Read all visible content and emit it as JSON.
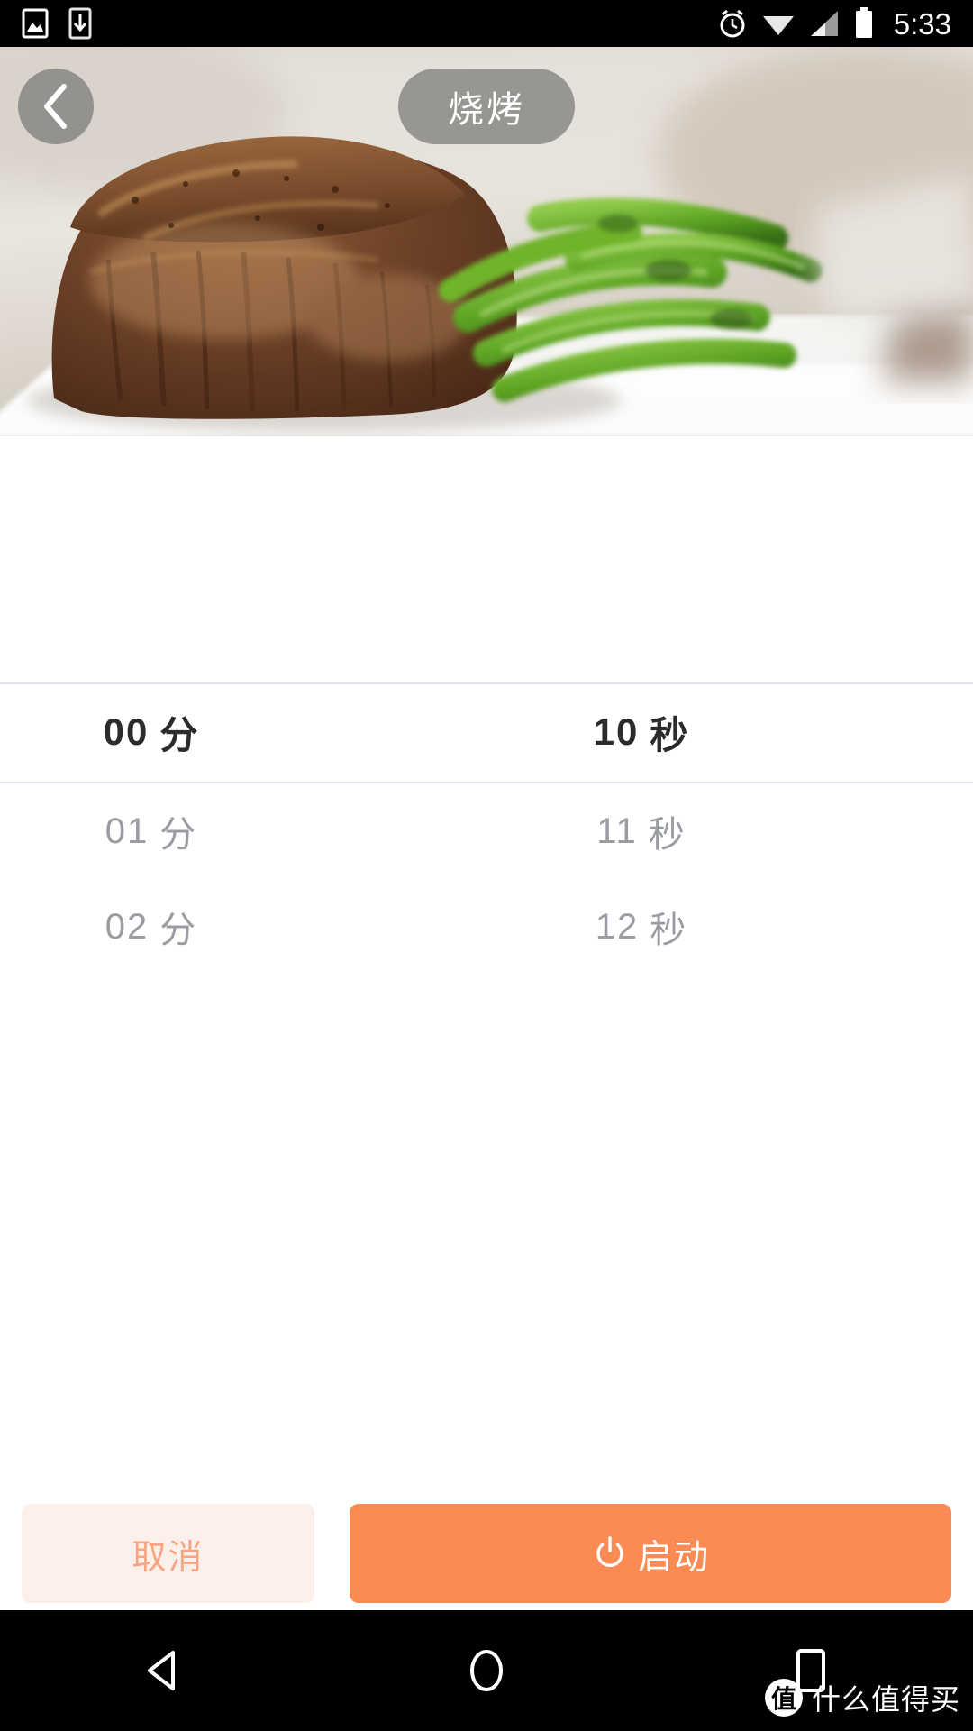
{
  "status_bar": {
    "time": "5:33",
    "left_icons": [
      "screenshot-icon",
      "download-icon"
    ],
    "right_icons": [
      "alarm-icon",
      "wifi-icon",
      "signal-icon",
      "battery-icon"
    ],
    "background_color": "#000000"
  },
  "hero": {
    "back_button_icon": "chevron-left-icon",
    "title": "烧烤",
    "pill_color": "rgba(120,120,118,0.72)",
    "photo_description": "grilled-steak-with-green-beans"
  },
  "picker": {
    "columns": [
      {
        "name": "minutes",
        "unit": "分",
        "rows": [
          {
            "value": "00",
            "unit": "分",
            "selected": true
          },
          {
            "value": "01",
            "unit": "分",
            "selected": false
          },
          {
            "value": "02",
            "unit": "分",
            "selected": false
          }
        ]
      },
      {
        "name": "seconds",
        "unit": "秒",
        "rows": [
          {
            "value": "10",
            "unit": "秒",
            "selected": true
          },
          {
            "value": "11",
            "unit": "秒",
            "selected": false
          },
          {
            "value": "12",
            "unit": "秒",
            "selected": false
          }
        ]
      }
    ],
    "selected_color": "#2b2b2e",
    "unselected_color": "#9a9ca3",
    "divider_color": "#dfe3eb"
  },
  "actions": {
    "cancel_label": "取消",
    "cancel_bg": "#fdf0ea",
    "cancel_text_color": "#f6a684",
    "start_label": "启动",
    "start_icon": "power-icon",
    "start_bg": "#fb8b54",
    "start_text_color": "#ffffff"
  },
  "navbar": {
    "back_icon": "triangle-back-icon",
    "home_icon": "circle-home-icon",
    "recents_icon": "square-recents-icon",
    "background_color": "#000000"
  },
  "watermark": {
    "badge": "值",
    "text": "什么值得买"
  }
}
